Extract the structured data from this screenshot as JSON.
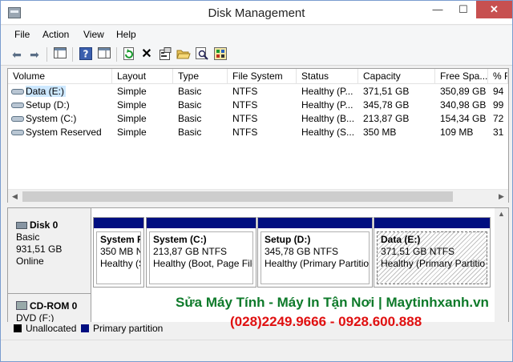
{
  "window": {
    "title": "Disk Management",
    "minimize": "—",
    "maximize": "☐",
    "close": "✕"
  },
  "menu": [
    "File",
    "Action",
    "View",
    "Help"
  ],
  "toolbar": {
    "icons": [
      "back-arrow-icon",
      "forward-arrow-icon",
      "console-tree-icon",
      "help-icon",
      "properties-pane-icon",
      "refresh-icon",
      "delete-icon",
      "properties-icon",
      "open-folder-icon",
      "search-icon",
      "export-icon"
    ]
  },
  "columns": [
    "Volume",
    "Layout",
    "Type",
    "File System",
    "Status",
    "Capacity",
    "Free Spa...",
    "% F"
  ],
  "volumes": [
    {
      "volume": "Data (E:)",
      "layout": "Simple",
      "type": "Basic",
      "fs": "NTFS",
      "status": "Healthy (P...",
      "capacity": "371,51 GB",
      "free": "350,89 GB",
      "pct": "94"
    },
    {
      "volume": "Setup (D:)",
      "layout": "Simple",
      "type": "Basic",
      "fs": "NTFS",
      "status": "Healthy (P...",
      "capacity": "345,78 GB",
      "free": "340,98 GB",
      "pct": "99"
    },
    {
      "volume": "System (C:)",
      "layout": "Simple",
      "type": "Basic",
      "fs": "NTFS",
      "status": "Healthy (B...",
      "capacity": "213,87 GB",
      "free": "154,34 GB",
      "pct": "72"
    },
    {
      "volume": "System Reserved",
      "layout": "Simple",
      "type": "Basic",
      "fs": "NTFS",
      "status": "Healthy (S...",
      "capacity": "350 MB",
      "free": "109 MB",
      "pct": "31"
    }
  ],
  "disk0": {
    "name": "Disk 0",
    "type": "Basic",
    "size": "931,51 GB",
    "state": "Online",
    "partitions": [
      {
        "name": "System R",
        "line1": "350 MB N",
        "line2": "Healthy (S"
      },
      {
        "name": "System  (C:)",
        "line1": "213,87 GB NTFS",
        "line2": "Healthy (Boot, Page File"
      },
      {
        "name": "Setup  (D:)",
        "line1": "345,78 GB NTFS",
        "line2": "Healthy (Primary Partitio"
      },
      {
        "name": "Data  (E:)",
        "line1": "371,51 GB NTFS",
        "line2": "Healthy (Primary Partitio"
      }
    ]
  },
  "cdrom0": {
    "name": "CD-ROM 0",
    "line": "DVD (F:)"
  },
  "legend": [
    {
      "label": "Unallocated",
      "color": "#000000"
    },
    {
      "label": "Primary partition",
      "color": "#000e80"
    }
  ],
  "watermark": {
    "line1": "Sửa Máy Tính - Máy In Tận Nơi | Maytinhxanh.vn",
    "line2": "(028)2249.9666 - 0928.600.888"
  }
}
